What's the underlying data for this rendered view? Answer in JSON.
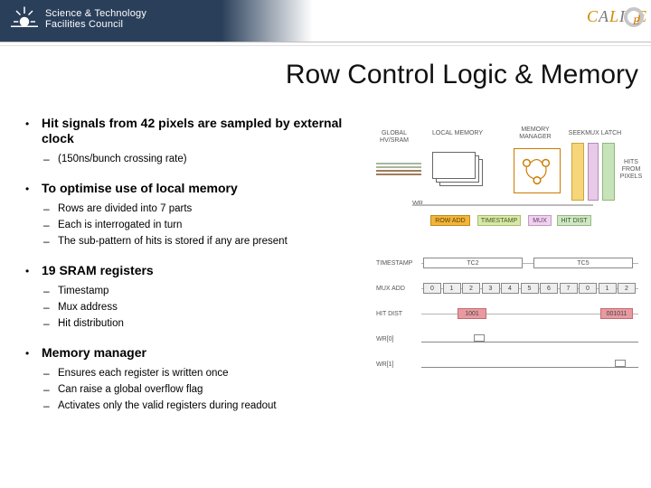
{
  "header": {
    "org_line1": "Science & Technology",
    "org_line2": "Facilities Council",
    "brand": "CALICE"
  },
  "title": "Row Control Logic & Memory",
  "bullets": [
    {
      "head": "Hit signals from 42 pixels are sampled by external clock",
      "subs": [
        "(150ns/bunch crossing rate)"
      ]
    },
    {
      "head": "To optimise use of local memory",
      "subs": [
        "Rows are divided into 7 parts",
        "Each is interrogated in turn",
        "The sub-pattern of hits is stored if any are present"
      ]
    },
    {
      "head": "19 SRAM registers",
      "subs": [
        "Timestamp",
        "Mux address",
        "Hit distribution"
      ]
    },
    {
      "head": "Memory manager",
      "subs": [
        "Ensures each register is written once",
        "Can raise a global overflow flag",
        "Activates only the valid registers during readout"
      ]
    }
  ],
  "blockdiag": {
    "labels": {
      "global": "GLOBAL",
      "hvsram": "HV/SRAM",
      "localmem": "LOCAL MEMORY",
      "memmgr": "MEMORY\nMANAGER",
      "seek": "SEEK",
      "mux": "MUX",
      "latch": "LATCH",
      "hits": "HITS\nFROM\nPIXELS",
      "wr": "WR",
      "rowadd": "ROW ADD",
      "timestamp": "TIMESTAMP",
      "muxbox": "MUX",
      "hitdist": "HIT DIST"
    }
  },
  "timing": {
    "rows": {
      "timestamp": "TIMESTAMP",
      "muxadd": "MUX ADD",
      "hitdist": "HIT DIST",
      "wr0": "WR[0]",
      "wr1": "WR[1]"
    },
    "tc_a": "TC2",
    "tc_b": "TC5",
    "mux_vals": [
      "0",
      "1",
      "2",
      "3",
      "4",
      "5",
      "6",
      "7",
      "0",
      "1",
      "2"
    ],
    "hit_a": "1001",
    "hit_b": "001011"
  }
}
